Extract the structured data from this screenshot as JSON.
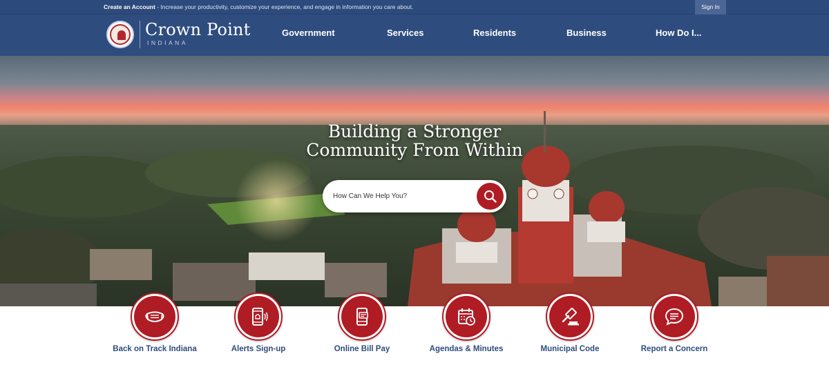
{
  "topbar": {
    "create_account": "Create an Account",
    "promo_text": " - Increase your productivity, customize your experience, and engage in information you care about.",
    "sign_in": "Sign In"
  },
  "header": {
    "logo_name": "Crown Point",
    "logo_state": "INDIANA",
    "nav": [
      {
        "label": "Government"
      },
      {
        "label": "Services"
      },
      {
        "label": "Residents"
      },
      {
        "label": "Business"
      },
      {
        "label": "How Do I..."
      }
    ]
  },
  "hero": {
    "title_line1": "Building a Stronger",
    "title_line2": "Community From Within",
    "search_placeholder": "How Can We Help You?"
  },
  "quick_links": [
    {
      "label": "Back on Track Indiana",
      "icon": "face-mask-icon"
    },
    {
      "label": "Alerts Sign-up",
      "icon": "mobile-alert-icon"
    },
    {
      "label": "Online Bill Pay",
      "icon": "mobile-payment-icon"
    },
    {
      "label": "Agendas & Minutes",
      "icon": "calendar-clock-icon"
    },
    {
      "label": "Municipal Code",
      "icon": "gavel-icon"
    },
    {
      "label": "Report a Concern",
      "icon": "chat-bubble-icon"
    }
  ],
  "colors": {
    "navy": "#2e4c7e",
    "brand_red": "#b01c24",
    "white": "#ffffff"
  }
}
